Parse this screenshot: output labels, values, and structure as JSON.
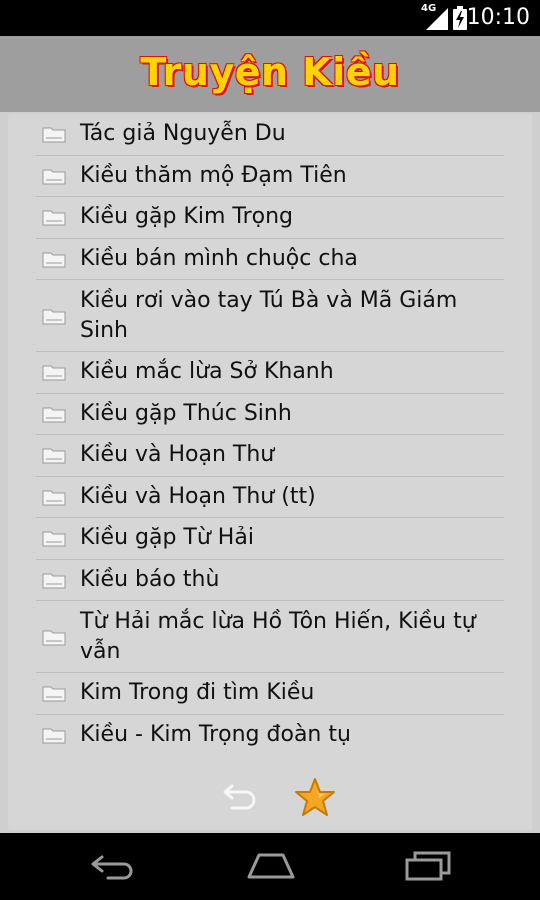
{
  "status_bar": {
    "network": "4G",
    "time": "10:10"
  },
  "header": {
    "title": "Truyện Kiều"
  },
  "chapters": [
    {
      "label": "Tác giả Nguyễn Du"
    },
    {
      "label": "Kiều thăm mộ Đạm Tiên"
    },
    {
      "label": "Kiều gặp Kim Trọng"
    },
    {
      "label": "Kiều bán mình chuộc cha"
    },
    {
      "label": "Kiều rơi vào tay Tú Bà và Mã Giám Sinh"
    },
    {
      "label": "Kiều mắc lừa Sở Khanh"
    },
    {
      "label": "Kiều gặp Thúc Sinh"
    },
    {
      "label": "Kiều và Hoạn Thư"
    },
    {
      "label": "Kiều và Hoạn Thư (tt)"
    },
    {
      "label": "Kiều gặp Từ Hải"
    },
    {
      "label": "Kiều báo thù"
    },
    {
      "label": "Từ Hải mắc lừa Hồ Tôn Hiến, Kiều tự vẫn"
    },
    {
      "label": "Kim Trong đi tìm Kiều"
    },
    {
      "label": "Kiều - Kim Trọng đoàn tụ"
    }
  ],
  "icons": {
    "list_item": "folder-icon",
    "back": "undo-arrow-icon",
    "favorite": "star-icon",
    "nav_back": "back-icon",
    "nav_home": "home-icon",
    "nav_recents": "recents-icon"
  },
  "colors": {
    "title_fill": "#ffd400",
    "title_outline": "#e01010",
    "header_bg": "#9e9e9e",
    "list_bg": "#d6d6d6",
    "star": "#f5a623"
  }
}
